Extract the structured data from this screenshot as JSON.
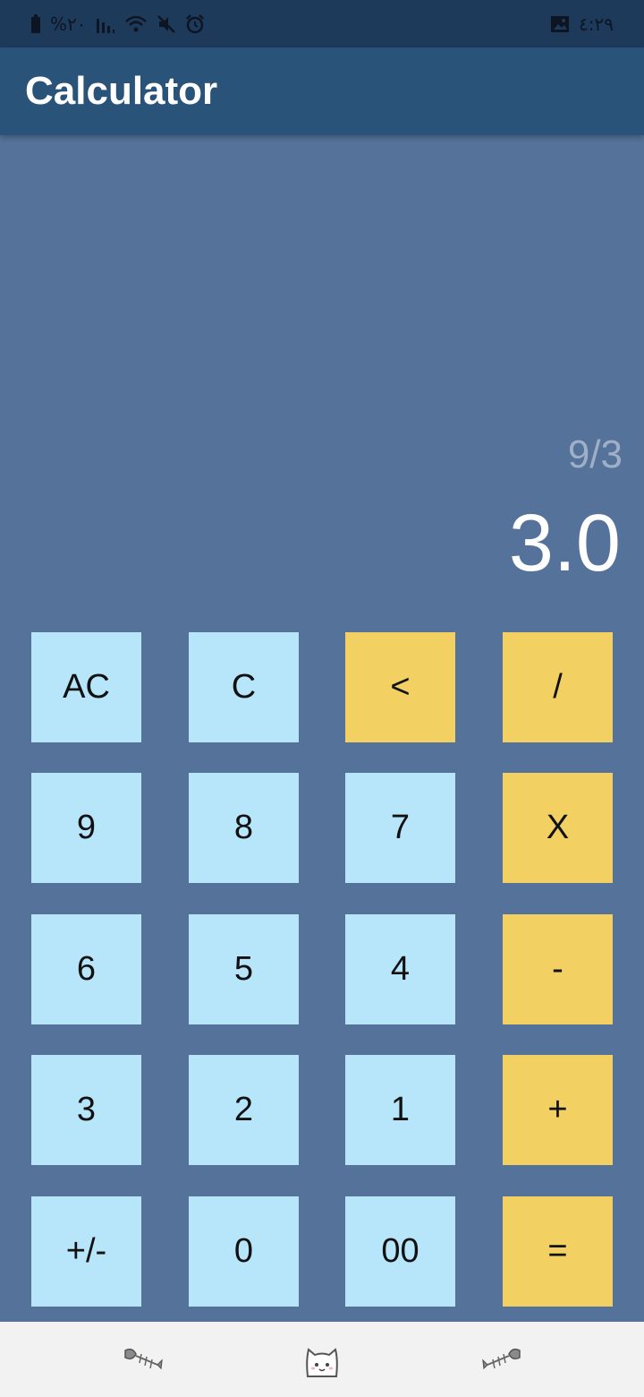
{
  "status_bar": {
    "battery_percent": "%٢٠",
    "time": "٤:٢٩",
    "icons": [
      "battery-icon",
      "signal-icon",
      "wifi-icon",
      "mute-icon",
      "alarm-icon",
      "image-icon"
    ]
  },
  "app_bar": {
    "title": "Calculator"
  },
  "display": {
    "expression": "9/3",
    "result": "3.0"
  },
  "keypad": {
    "rows": [
      [
        {
          "label": "AC",
          "kind": "num"
        },
        {
          "label": "C",
          "kind": "num"
        },
        {
          "label": "<",
          "kind": "op"
        },
        {
          "label": "/",
          "kind": "op"
        }
      ],
      [
        {
          "label": "9",
          "kind": "num"
        },
        {
          "label": "8",
          "kind": "num"
        },
        {
          "label": "7",
          "kind": "num"
        },
        {
          "label": "X",
          "kind": "op"
        }
      ],
      [
        {
          "label": "6",
          "kind": "num"
        },
        {
          "label": "5",
          "kind": "num"
        },
        {
          "label": "4",
          "kind": "num"
        },
        {
          "label": "-",
          "kind": "op"
        }
      ],
      [
        {
          "label": "3",
          "kind": "num"
        },
        {
          "label": "2",
          "kind": "num"
        },
        {
          "label": "1",
          "kind": "num"
        },
        {
          "label": "+",
          "kind": "op"
        }
      ],
      [
        {
          "label": "+/-",
          "kind": "num"
        },
        {
          "label": "0",
          "kind": "num"
        },
        {
          "label": "00",
          "kind": "num"
        },
        {
          "label": "=",
          "kind": "op"
        }
      ]
    ]
  },
  "bottom_nav": {
    "items": [
      "fish-bone-icon",
      "cat-icon",
      "fish-bone-icon"
    ]
  },
  "colors": {
    "background": "#55739a",
    "app_bar": "#2a5379",
    "status_bar": "#1e3a5b",
    "number_key": "#b7e5fa",
    "operator_key": "#f3d062",
    "expression_text": "#9eafc6",
    "result_text": "#ffffff",
    "bottom_nav": "#f2f2f2"
  }
}
